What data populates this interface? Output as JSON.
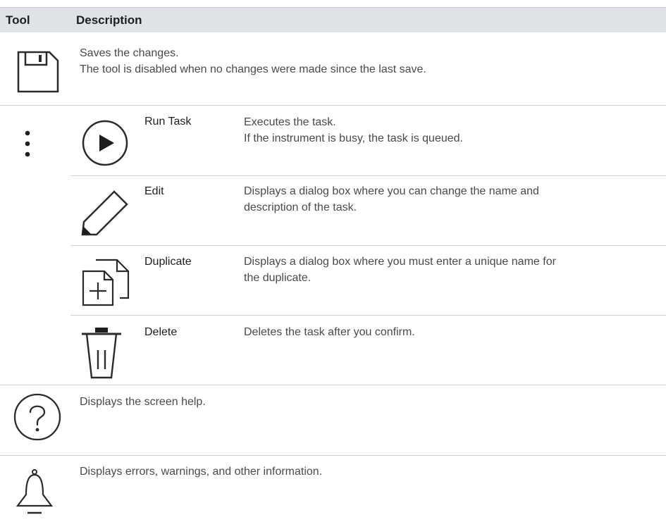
{
  "header": {
    "col_tool": "Tool",
    "col_description": "Description"
  },
  "rows": {
    "save": {
      "icon": "save-icon",
      "line1": "Saves the changes.",
      "line2": "The tool is disabled when no changes were made since the last save."
    },
    "more": {
      "icon": "more-vertical-icon",
      "items": [
        {
          "icon": "play-circle-icon",
          "label": "Run Task",
          "line1": "Executes the task.",
          "line2": "If the instrument is busy, the task is queued."
        },
        {
          "icon": "pencil-icon",
          "label": "Edit",
          "line1": "Displays a dialog box where you can change the name and",
          "line2": "description of the task."
        },
        {
          "icon": "duplicate-icon",
          "label": "Duplicate",
          "line1": "Displays a dialog box where you must enter a unique name for",
          "line2": "the duplicate."
        },
        {
          "icon": "trash-icon",
          "label": "Delete",
          "line1": "Deletes the task after you confirm.",
          "line2": ""
        }
      ]
    },
    "help": {
      "icon": "help-icon",
      "line1": "Displays the screen help."
    },
    "notifications": {
      "icon": "bell-icon",
      "line1": "Displays errors, warnings, and other information."
    }
  }
}
